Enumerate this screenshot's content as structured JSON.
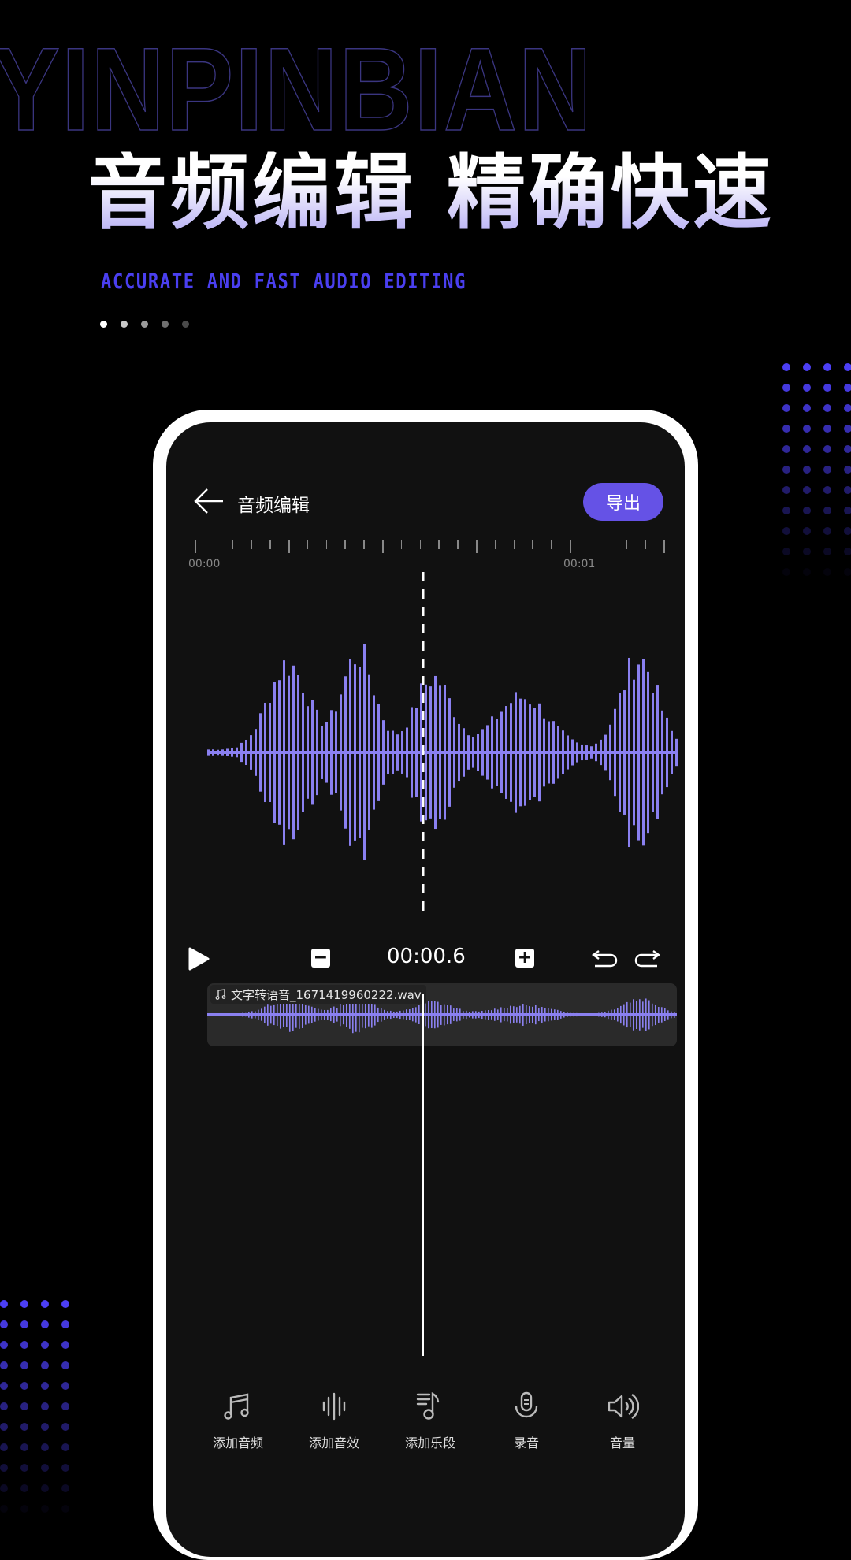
{
  "background_word": "YINPINBIAN",
  "headline": "音频编辑  精确快速",
  "subheadline": "ACCURATE AND FAST AUDIO EDITING",
  "pager": {
    "count": 5,
    "active_index": 0
  },
  "colors": {
    "accent": "#6552e6",
    "brand_blue": "#4a3ff0",
    "waveform": "#8a80f0",
    "screen_bg": "#111111",
    "track_bg": "#2a2a2a"
  },
  "app": {
    "title": "音频编辑",
    "back_icon": "arrow-left-icon",
    "export_label": "导出",
    "ruler": {
      "labels": [
        "00:00",
        "00:01"
      ]
    },
    "controls": {
      "play_icon": "play-icon",
      "zoom_out_icon": "minus-square-icon",
      "timecode": "00:00.6",
      "zoom_in_icon": "plus-square-icon",
      "undo_icon": "undo-icon",
      "redo_icon": "redo-icon"
    },
    "track": {
      "icon": "music-note-icon",
      "filename": "文字转语音_1671419960222.wav"
    },
    "tools": [
      {
        "label": "添加音频",
        "icon": "music-notes-icon"
      },
      {
        "label": "添加音效",
        "icon": "sound-wave-icon"
      },
      {
        "label": "添加乐段",
        "icon": "playlist-note-icon"
      },
      {
        "label": "录音",
        "icon": "microphone-icon"
      },
      {
        "label": "音量",
        "icon": "volume-icon"
      }
    ]
  }
}
